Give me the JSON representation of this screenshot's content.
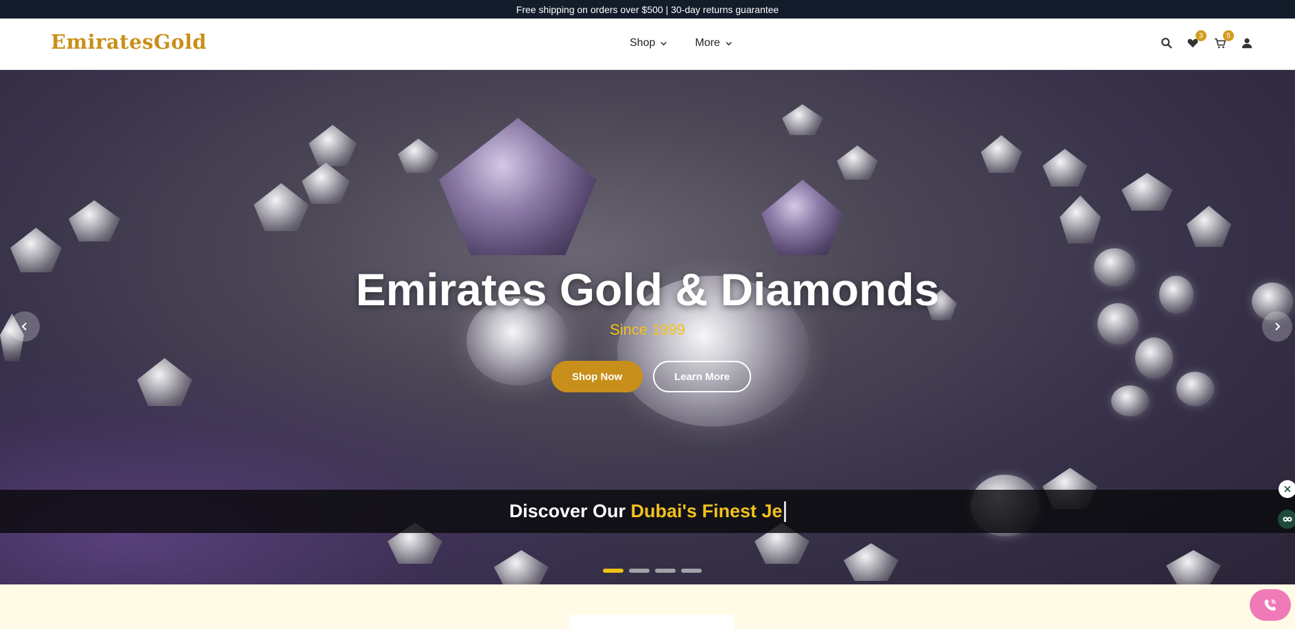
{
  "announcement": {
    "text": "Free shipping on orders over $500 | 30-day returns guarantee"
  },
  "header": {
    "logo": "EmiratesGold",
    "nav": [
      {
        "label": "Shop",
        "icon": "chevron-down-icon"
      },
      {
        "label": "More",
        "icon": "chevron-down-icon"
      }
    ],
    "icons": {
      "search": "search-icon",
      "wishlist": "heart-icon",
      "cart": "cart-icon",
      "account": "user-icon"
    },
    "wishlist_count": "3",
    "cart_count": "5"
  },
  "hero": {
    "title": "Emirates Gold & Diamonds",
    "subtitle": "Since 1999",
    "primary_button": "Shop Now",
    "secondary_button": "Learn More",
    "ticker_prefix": "Discover Our ",
    "ticker_highlight": "Dubai's Finest Je",
    "slide_count": 4,
    "active_slide": 1
  },
  "colors": {
    "accent_gold": "#c8901a",
    "highlight_yellow": "#f2c21c",
    "announcement_bg": "#131c2b",
    "cream_section": "#fffbe6",
    "call_button": "#f07ab8"
  }
}
